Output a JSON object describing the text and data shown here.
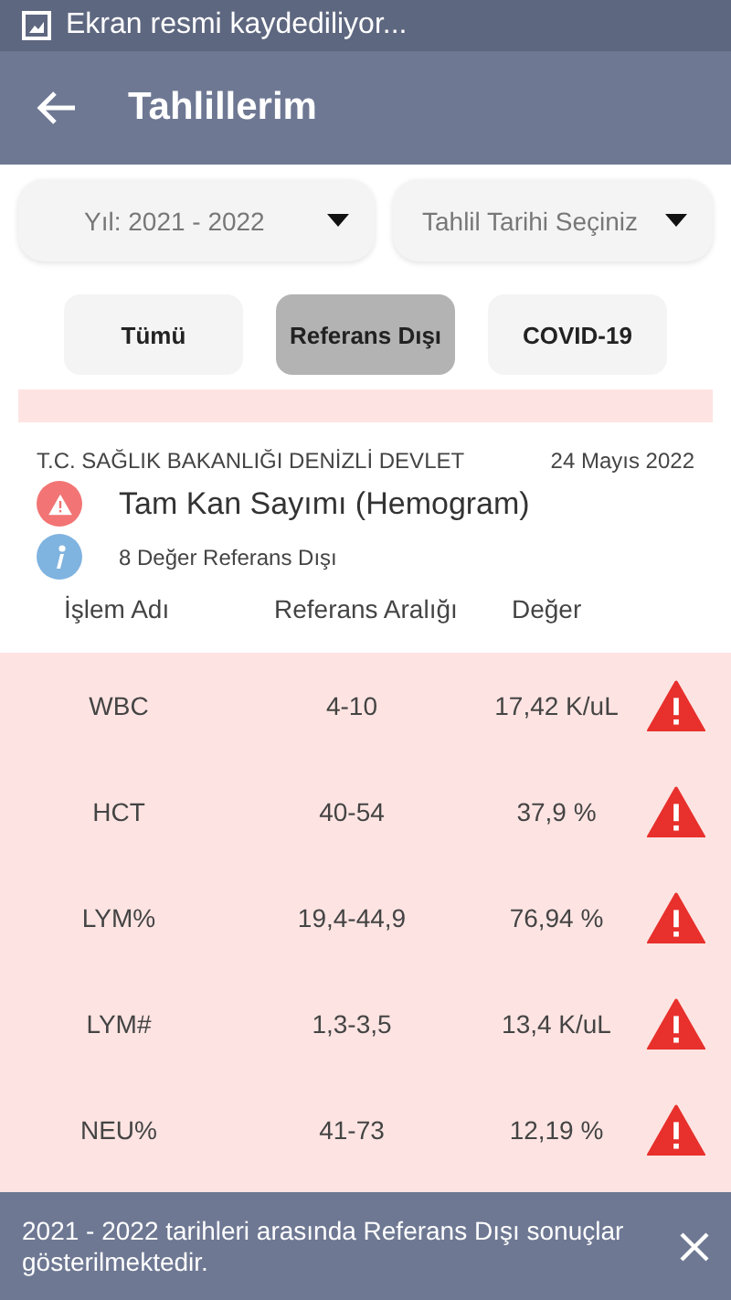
{
  "status_bar": {
    "notification": "Ekran resmi kaydediliyor..."
  },
  "app_bar": {
    "title": "Tahlillerim"
  },
  "dropdowns": [
    {
      "value": "Yıl: 2021 - 2022"
    },
    {
      "value": "Tahlil Tarihi Seçiniz"
    }
  ],
  "filters": [
    {
      "label": "Tümü",
      "selected": false
    },
    {
      "label": "Referans Dışı",
      "selected": true
    },
    {
      "label": "COVID-19",
      "selected": false
    }
  ],
  "result": {
    "institution": "T.C. SAĞLIK BAKANLIĞI DENİZLİ DEVLET",
    "date": "24 Mayıs 2022",
    "test_name": "Tam Kan Sayımı (Hemogram)",
    "summary": "8 Değer Referans Dışı"
  },
  "table": {
    "columns": [
      "İşlem Adı",
      "Referans Aralığı",
      "Değer"
    ],
    "rows": [
      {
        "name": "WBC",
        "range": "4-10",
        "value": "17,42 K/uL",
        "out_of_range": true
      },
      {
        "name": "HCT",
        "range": "40-54",
        "value": "37,9 %",
        "out_of_range": true
      },
      {
        "name": "LYM%",
        "range": "19,4-44,9",
        "value": "76,94 %",
        "out_of_range": true
      },
      {
        "name": "LYM#",
        "range": "1,3-3,5",
        "value": "13,4 K/uL",
        "out_of_range": true
      },
      {
        "name": "NEU%",
        "range": "41-73",
        "value": "12,19 %",
        "out_of_range": true
      }
    ]
  },
  "snackbar": {
    "message": "2021 - 2022 tarihleri arasında Referans Dışı sonuçlar gösterilmektedir."
  }
}
